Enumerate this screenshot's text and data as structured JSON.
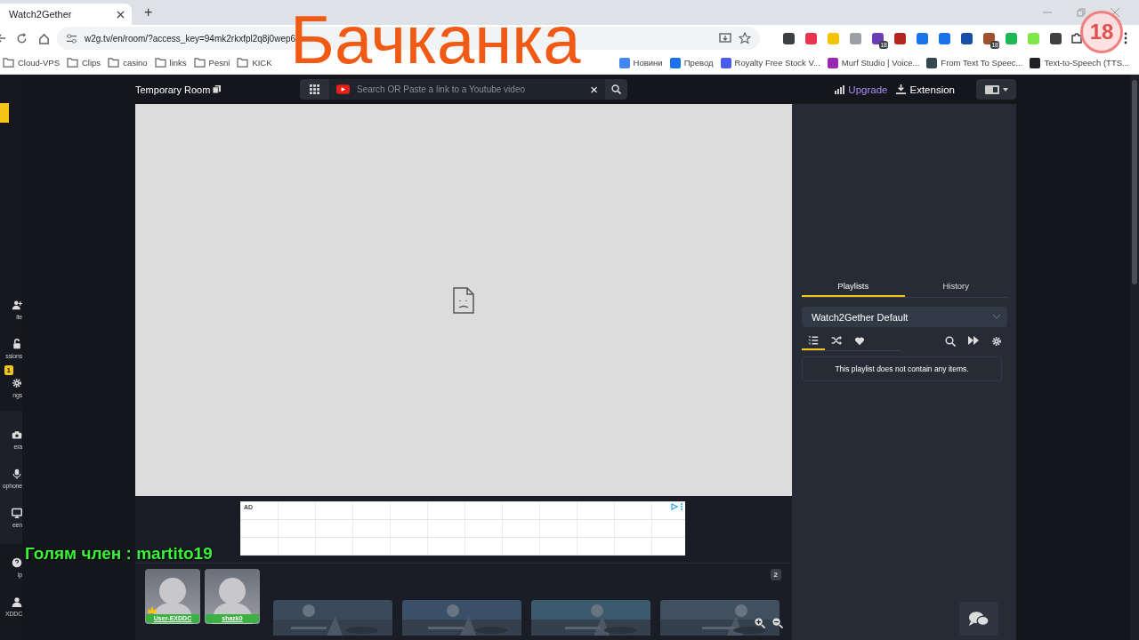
{
  "browser": {
    "tab_title": "Watch2Gether",
    "new_tab": "+",
    "url": "w2g.tv/en/room/?access_key=94mk2rkxfpl2q8j0wep6",
    "extensions": [
      {
        "color": "#3c4043"
      },
      {
        "color": "#e8344e"
      },
      {
        "color": "#f3c400"
      },
      {
        "color": "#9aa0a6"
      },
      {
        "color": "#6a3fb5",
        "badge": "18"
      },
      {
        "color": "#b3261e"
      },
      {
        "color": "#1a73e8"
      },
      {
        "color": "#1a73e8"
      },
      {
        "color": "#174ea6"
      },
      {
        "color": "#a0522d",
        "badge": "18"
      },
      {
        "color": "#1db954"
      },
      {
        "color": "#7ee84b"
      },
      {
        "color": "#3c4043"
      }
    ],
    "bookmarks": [
      {
        "kind": "folder",
        "label": "Cloud-VPS"
      },
      {
        "kind": "folder",
        "label": "Clips"
      },
      {
        "kind": "folder",
        "label": "casino"
      },
      {
        "kind": "folder",
        "label": "links"
      },
      {
        "kind": "folder",
        "label": "Pesni"
      },
      {
        "kind": "folder",
        "label": "KICK"
      },
      {
        "kind": "gap"
      },
      {
        "kind": "site",
        "label": "Новини",
        "color": "#4285f4"
      },
      {
        "kind": "site",
        "label": "Превод",
        "color": "#1a73e8"
      },
      {
        "kind": "site",
        "label": "Royalty Free Stock V...",
        "color": "#4a5cf0"
      },
      {
        "kind": "site",
        "label": "Murf Studio | Voice...",
        "color": "#9c27b0"
      },
      {
        "kind": "site",
        "label": "From Text To Speec...",
        "color": "#37474f"
      },
      {
        "kind": "site",
        "label": "Text-to-Speech (TTS...",
        "color": "#202124"
      }
    ]
  },
  "sidebar": {
    "sections": [
      {
        "panel": false,
        "items": [
          {
            "kind": "invite",
            "label": "ite"
          },
          {
            "kind": "lock",
            "label": "ssions",
            "badge": "1"
          },
          {
            "kind": "gear",
            "label": "ngs"
          }
        ]
      },
      {
        "panel": true,
        "items": [
          {
            "kind": "camera",
            "label": "era"
          },
          {
            "kind": "mic",
            "label": "ophone"
          },
          {
            "kind": "screen",
            "label": "een"
          }
        ]
      },
      {
        "panel": false,
        "items": [
          {
            "kind": "help",
            "label": "lp"
          },
          {
            "kind": "user",
            "label": "XDDC"
          }
        ]
      }
    ]
  },
  "header": {
    "room_title": "Temporary Room",
    "search": {
      "placeholder": "Search OR Paste a link to a Youtube video",
      "clear": "×"
    },
    "upgrade": "Upgrade",
    "extension": "Extension"
  },
  "ad": {
    "label": "AD"
  },
  "users": {
    "count": "2",
    "items": [
      {
        "name": "User-EXDDC",
        "host": true
      },
      {
        "name": "shazk0",
        "host": false
      }
    ]
  },
  "panel": {
    "tabs": [
      {
        "label": "Playlists",
        "selected": true
      },
      {
        "label": "History",
        "selected": false
      }
    ],
    "playlist": "Watch2Gether Default",
    "tools": [
      {
        "kind": "list",
        "selected": true
      },
      {
        "kind": "shuffle",
        "selected": false
      },
      {
        "kind": "heart",
        "selected": false
      }
    ],
    "empty": "This playlist does not contain any items."
  },
  "overlay": {
    "title": "Бачканка",
    "chat": "Голям член : martito19",
    "age_badge": "18"
  }
}
